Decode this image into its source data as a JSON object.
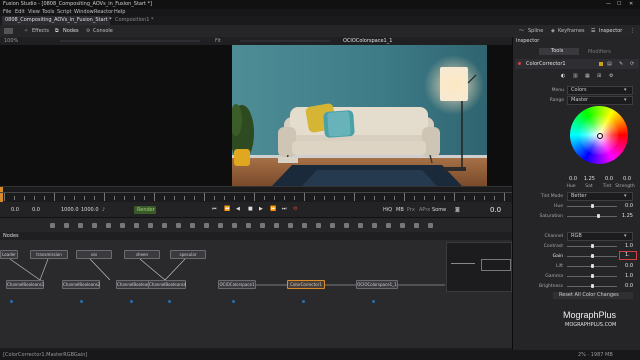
{
  "window": {
    "title": "Fusion Studio - [0808_Compositing_AOVs_in_Fusion_Start *]",
    "menu": [
      "File",
      "Edit",
      "View",
      "Tools",
      "Script",
      "Window",
      "Reactor",
      "Help"
    ],
    "tabs": [
      "0808_Compositing_AOVs_in_Fusion_Start *",
      "Composition1 *"
    ]
  },
  "toolbar": {
    "effects": "Effects",
    "nodes": "Nodes",
    "console": "Console",
    "spline": "Spline",
    "keyframes": "Keyframes",
    "inspector": "Inspector"
  },
  "viewer": {
    "zoom_left": "100%",
    "zoom_right": "Fit",
    "title": "OCIOColorspace1_1"
  },
  "transport": {
    "start": "0.0",
    "current": "0.0",
    "end_a": "1000.0",
    "end_b": "1000.0",
    "render": "Render",
    "hiq": "HiQ",
    "mb": "MB",
    "prx": "Prx",
    "aprx": "APrx",
    "some": "Some",
    "frame": "0.0"
  },
  "nodes_panel": {
    "header": "Nodes",
    "loaders": [
      "Loader",
      "transmission",
      "sss",
      "sheen",
      "specular"
    ],
    "chain": [
      "ChannelBooleans1",
      "ChannelBooleans2",
      "ChannelBooleans3",
      "ChannelBooleans4",
      "OCIOColorspace1",
      "ColorCorrector1",
      "OCIOColorspace1_1"
    ]
  },
  "inspector": {
    "header": "Inspector",
    "tab_tools": "Tools",
    "tab_modifiers": "Modifiers",
    "node_name": "ColorCorrector1",
    "menu_label": "Menu",
    "menu_value": "Colors",
    "range_label": "Range",
    "range_value": "Master",
    "hue_values": [
      "0.0",
      "1.25",
      "0.0",
      "0.0"
    ],
    "hue_labels": [
      "Hue",
      "Sat",
      "Tint",
      "Strength"
    ],
    "tint_mode_label": "Tint Mode",
    "tint_mode_value": "Better",
    "hue_label": "Hue",
    "hue_value": "0.0",
    "saturation_label": "Saturation",
    "saturation_value": "1.25",
    "channel_label": "Channel",
    "channel_value": "RGB",
    "contrast_label": "Contrast",
    "contrast_value": "1.0",
    "gain_label": "Gain",
    "gain_value": "1.",
    "lift_label": "Lift",
    "lift_value": "0.0",
    "gamma_label": "Gamma",
    "gamma_value": "1.0",
    "brightness_label": "Brightness",
    "brightness_value": "0.0",
    "reset": "Reset All Color Changes"
  },
  "watermark": {
    "brand": "MographPlus",
    "url": "MOGRAPHPLUS.COM"
  },
  "status": {
    "left": "[ColorCorrector1.MasterRGBGain]",
    "right": "2%  ·  1987 MB"
  }
}
